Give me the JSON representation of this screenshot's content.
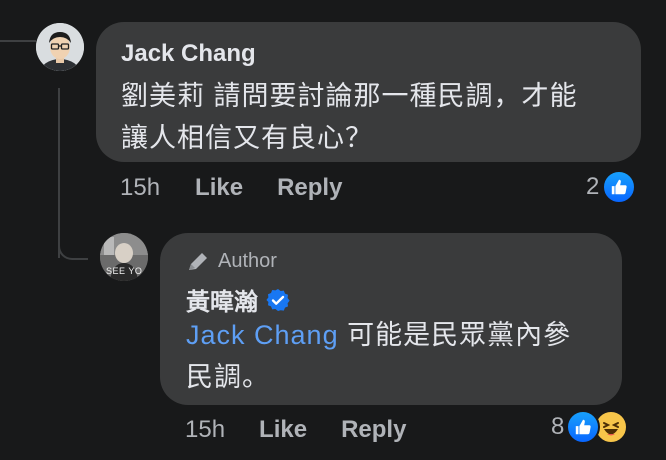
{
  "comment": {
    "author": "Jack Chang",
    "text_line1": "劉美莉 請問要討論那一種民調，才能",
    "text_line2": "讓人相信又有良心？",
    "time": "15h",
    "like_label": "Like",
    "reply_label": "Reply",
    "reaction_count": "2",
    "reactions": [
      "like-icon"
    ]
  },
  "reply": {
    "badge_label": "Author",
    "author": "黃暐瀚",
    "verified": true,
    "mention": "Jack Chang",
    "text_after_mention": " 可能是民眾黨內參",
    "text_line2": "民調。",
    "avatar_caption": "SEE YO",
    "time": "15h",
    "like_label": "Like",
    "reply_label": "Reply",
    "reaction_count": "8",
    "reactions": [
      "like-icon",
      "haha-icon"
    ]
  },
  "colors": {
    "background": "#18191a",
    "bubble": "#3a3b3c",
    "text": "#e4e6eb",
    "muted": "#b0b3b8",
    "mention": "#5e9ff5",
    "like_blue": "#1877f2",
    "verified_blue": "#1877f2"
  }
}
